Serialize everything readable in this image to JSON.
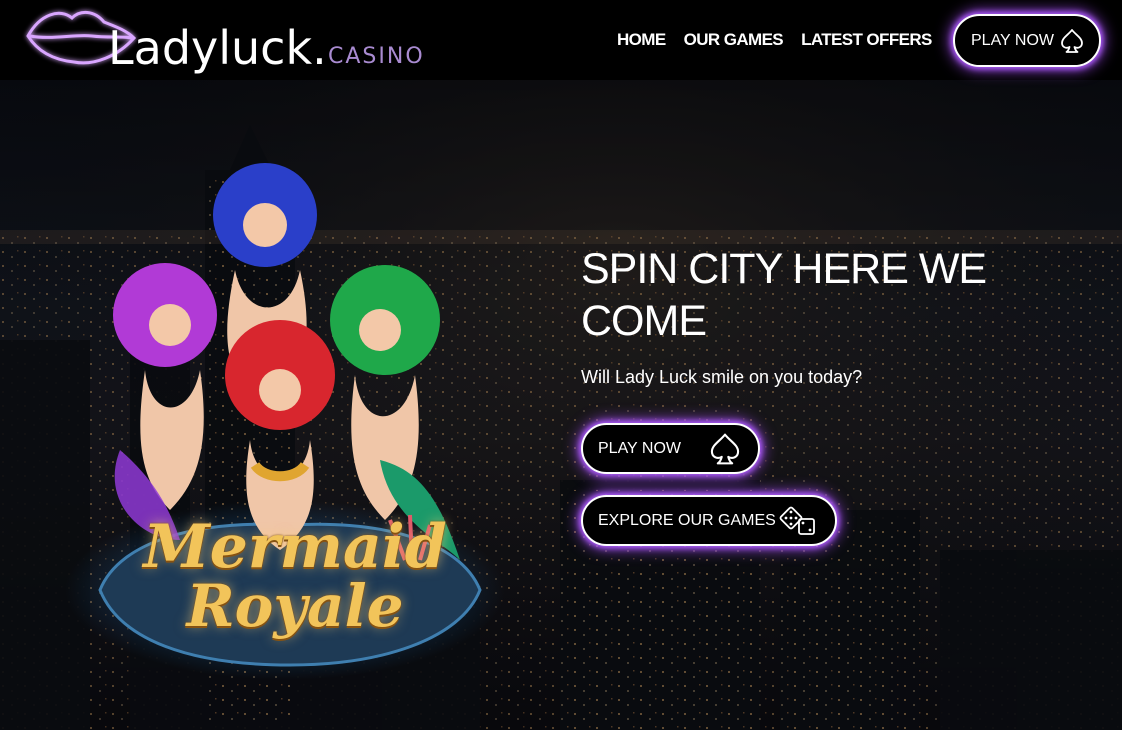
{
  "header": {
    "logo_text": "Ladyluck.",
    "logo_sub": "CASINO",
    "nav": [
      {
        "label": "HOME"
      },
      {
        "label": "OUR GAMES"
      },
      {
        "label": "LATEST OFFERS"
      }
    ],
    "play_button": {
      "label": "PLAY NOW",
      "icon": "spade-icon"
    }
  },
  "hero": {
    "title": "SPIN CITY HERE WE COME",
    "subtitle": "Will Lady Luck smile on you today?",
    "play_button": {
      "label": "PLAY NOW",
      "icon": "spade-icon"
    },
    "explore_button": {
      "label": "EXPLORE OUR GAMES",
      "icon": "dice-icon"
    },
    "game": {
      "line1": "Mermaid",
      "line2": "Royale"
    }
  },
  "colors": {
    "accent_glow": "#b05cff",
    "casino_text": "#a98bd1",
    "background": "#000000"
  }
}
